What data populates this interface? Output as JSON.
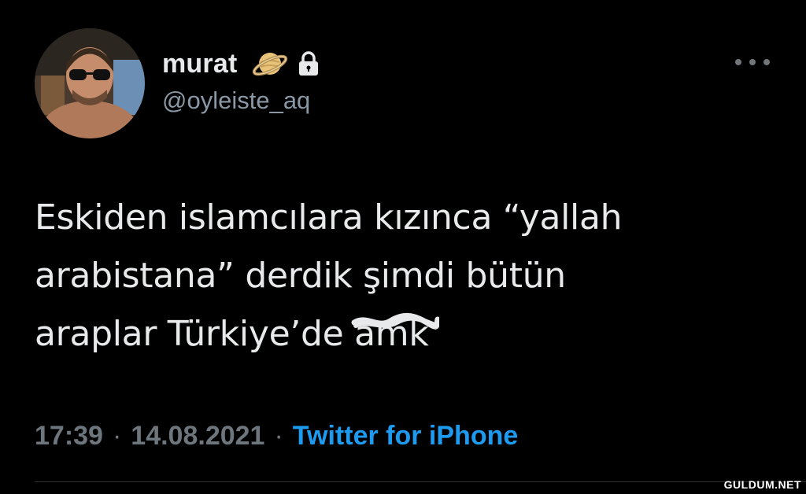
{
  "user": {
    "display_name": "murat",
    "handle": "@oyleiste_aq",
    "name_emoji_icon": "ringed-planet-emoji",
    "protected_icon": "lock-icon",
    "avatar_alt": "profile photo"
  },
  "header": {
    "more_icon": "more-horizontal-icon"
  },
  "tweet": {
    "lines": [
      "Eskiden islamcılara kızınca “yallah",
      "arabistana” derdik şimdi bütün",
      "araplar Türkiye’de "
    ],
    "scribbled_word": "amk"
  },
  "meta": {
    "time": "17:39",
    "separator": "·",
    "date": "14.08.2021",
    "source": "Twitter for iPhone"
  },
  "watermark": {
    "text": "GULDUM.NET"
  },
  "colors": {
    "background": "#000000",
    "text_primary": "#e7e9ea",
    "text_secondary": "#8b98a5",
    "link": "#1d9bf0",
    "divider": "#2f3336"
  }
}
